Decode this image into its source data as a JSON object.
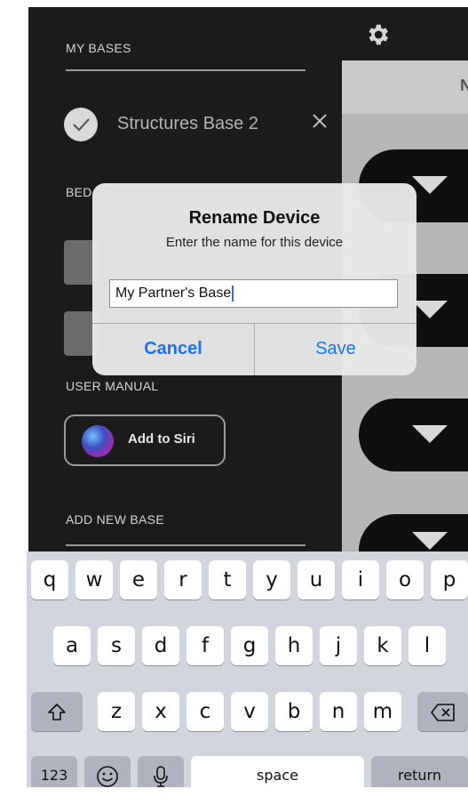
{
  "sidebar": {
    "my_bases_heading": "MY BASES",
    "base_name": "Structures Base 2",
    "bed_heading_partial": "BED",
    "user_manual_heading": "USER MANUAL",
    "siri_button_label": "Add to Siri",
    "add_new_base_heading": "ADD NEW BASE"
  },
  "background_panel": {
    "header_letter": "N"
  },
  "dialog": {
    "title": "Rename Device",
    "message": "Enter the name for this device",
    "input_value": "My Partner's Base",
    "cancel_label": "Cancel",
    "save_label": "Save"
  },
  "keyboard": {
    "row1": [
      "q",
      "w",
      "e",
      "r",
      "t",
      "y",
      "u",
      "i",
      "o",
      "p"
    ],
    "row2": [
      "a",
      "s",
      "d",
      "f",
      "g",
      "h",
      "j",
      "k",
      "l"
    ],
    "row3": [
      "z",
      "x",
      "c",
      "v",
      "b",
      "n",
      "m"
    ],
    "numbers_label": "123",
    "space_label": "space",
    "return_label": "return",
    "shift_icon": "shift-icon",
    "delete_icon": "delete-icon",
    "emoji_icon": "emoji-icon",
    "mic_icon": "microphone-icon"
  },
  "colors": {
    "accent": "#1a73e8",
    "app_background": "#1b1b1b",
    "keyboard_background": "#d1d5dc"
  }
}
